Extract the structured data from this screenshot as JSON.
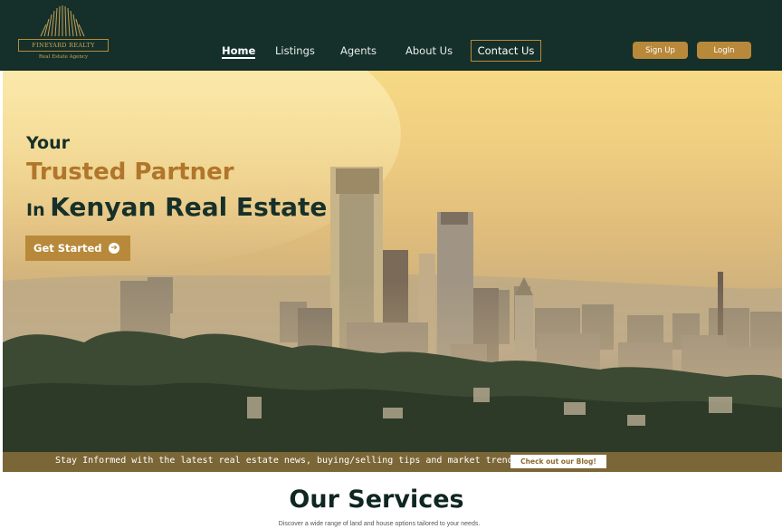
{
  "header": {
    "logo_name": "FINEYARD REALTY",
    "logo_tagline": "Real Estate Agency",
    "nav": [
      {
        "label": "Home",
        "active": true
      },
      {
        "label": "Listings"
      },
      {
        "label": "Agents"
      },
      {
        "label": "About Us"
      },
      {
        "label": "Contact Us"
      }
    ],
    "signup_label": "Sign Up",
    "login_label": "LogIn"
  },
  "hero": {
    "line1": "Your",
    "line2": "Trusted Partner",
    "line3_prefix": "In",
    "line3_main": "Kenyan Real Estate",
    "cta_label": "Get Started",
    "cta_icon": "arrow-right-circle-icon"
  },
  "ticker": {
    "text": "Stay Informed with the latest real estate news, buying/selling tips and market trends...",
    "button_label": "Check out our Blog!"
  },
  "services": {
    "title": "Our Services",
    "subtitle": "Discover a wide range of land and house options tailored to your needs."
  },
  "colors": {
    "nav_bg": "#15302a",
    "gold": "#b8893a",
    "dark_green": "#17302a",
    "accent_text": "#b0762b"
  }
}
